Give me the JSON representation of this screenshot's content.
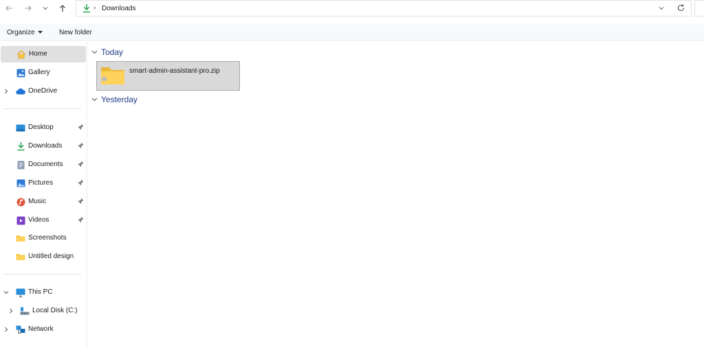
{
  "address": {
    "path": "Downloads",
    "separator": "›"
  },
  "commands": {
    "organize_label": "Organize",
    "new_folder_label": "New folder"
  },
  "sidebar": {
    "items": [
      {
        "label": "Home"
      },
      {
        "label": "Gallery"
      },
      {
        "label": "OneDrive"
      },
      {
        "label": "Desktop"
      },
      {
        "label": "Downloads"
      },
      {
        "label": "Documents"
      },
      {
        "label": "Pictures"
      },
      {
        "label": "Music"
      },
      {
        "label": "Videos"
      },
      {
        "label": "Screenshots"
      },
      {
        "label": "Untitled design"
      },
      {
        "label": "This PC"
      },
      {
        "label": "Local Disk (C:)"
      },
      {
        "label": "Network"
      }
    ]
  },
  "content": {
    "groups": [
      {
        "label": "Today"
      },
      {
        "label": "Yesterday"
      }
    ],
    "files": [
      {
        "name": "smart-admin-assistant-pro.zip"
      }
    ]
  },
  "colors": {
    "group_header": "#1f3b8a",
    "accent_green": "#1a9c3e",
    "folder_yellow": "#f5c542",
    "selected_bg": "#d9d9d9"
  }
}
